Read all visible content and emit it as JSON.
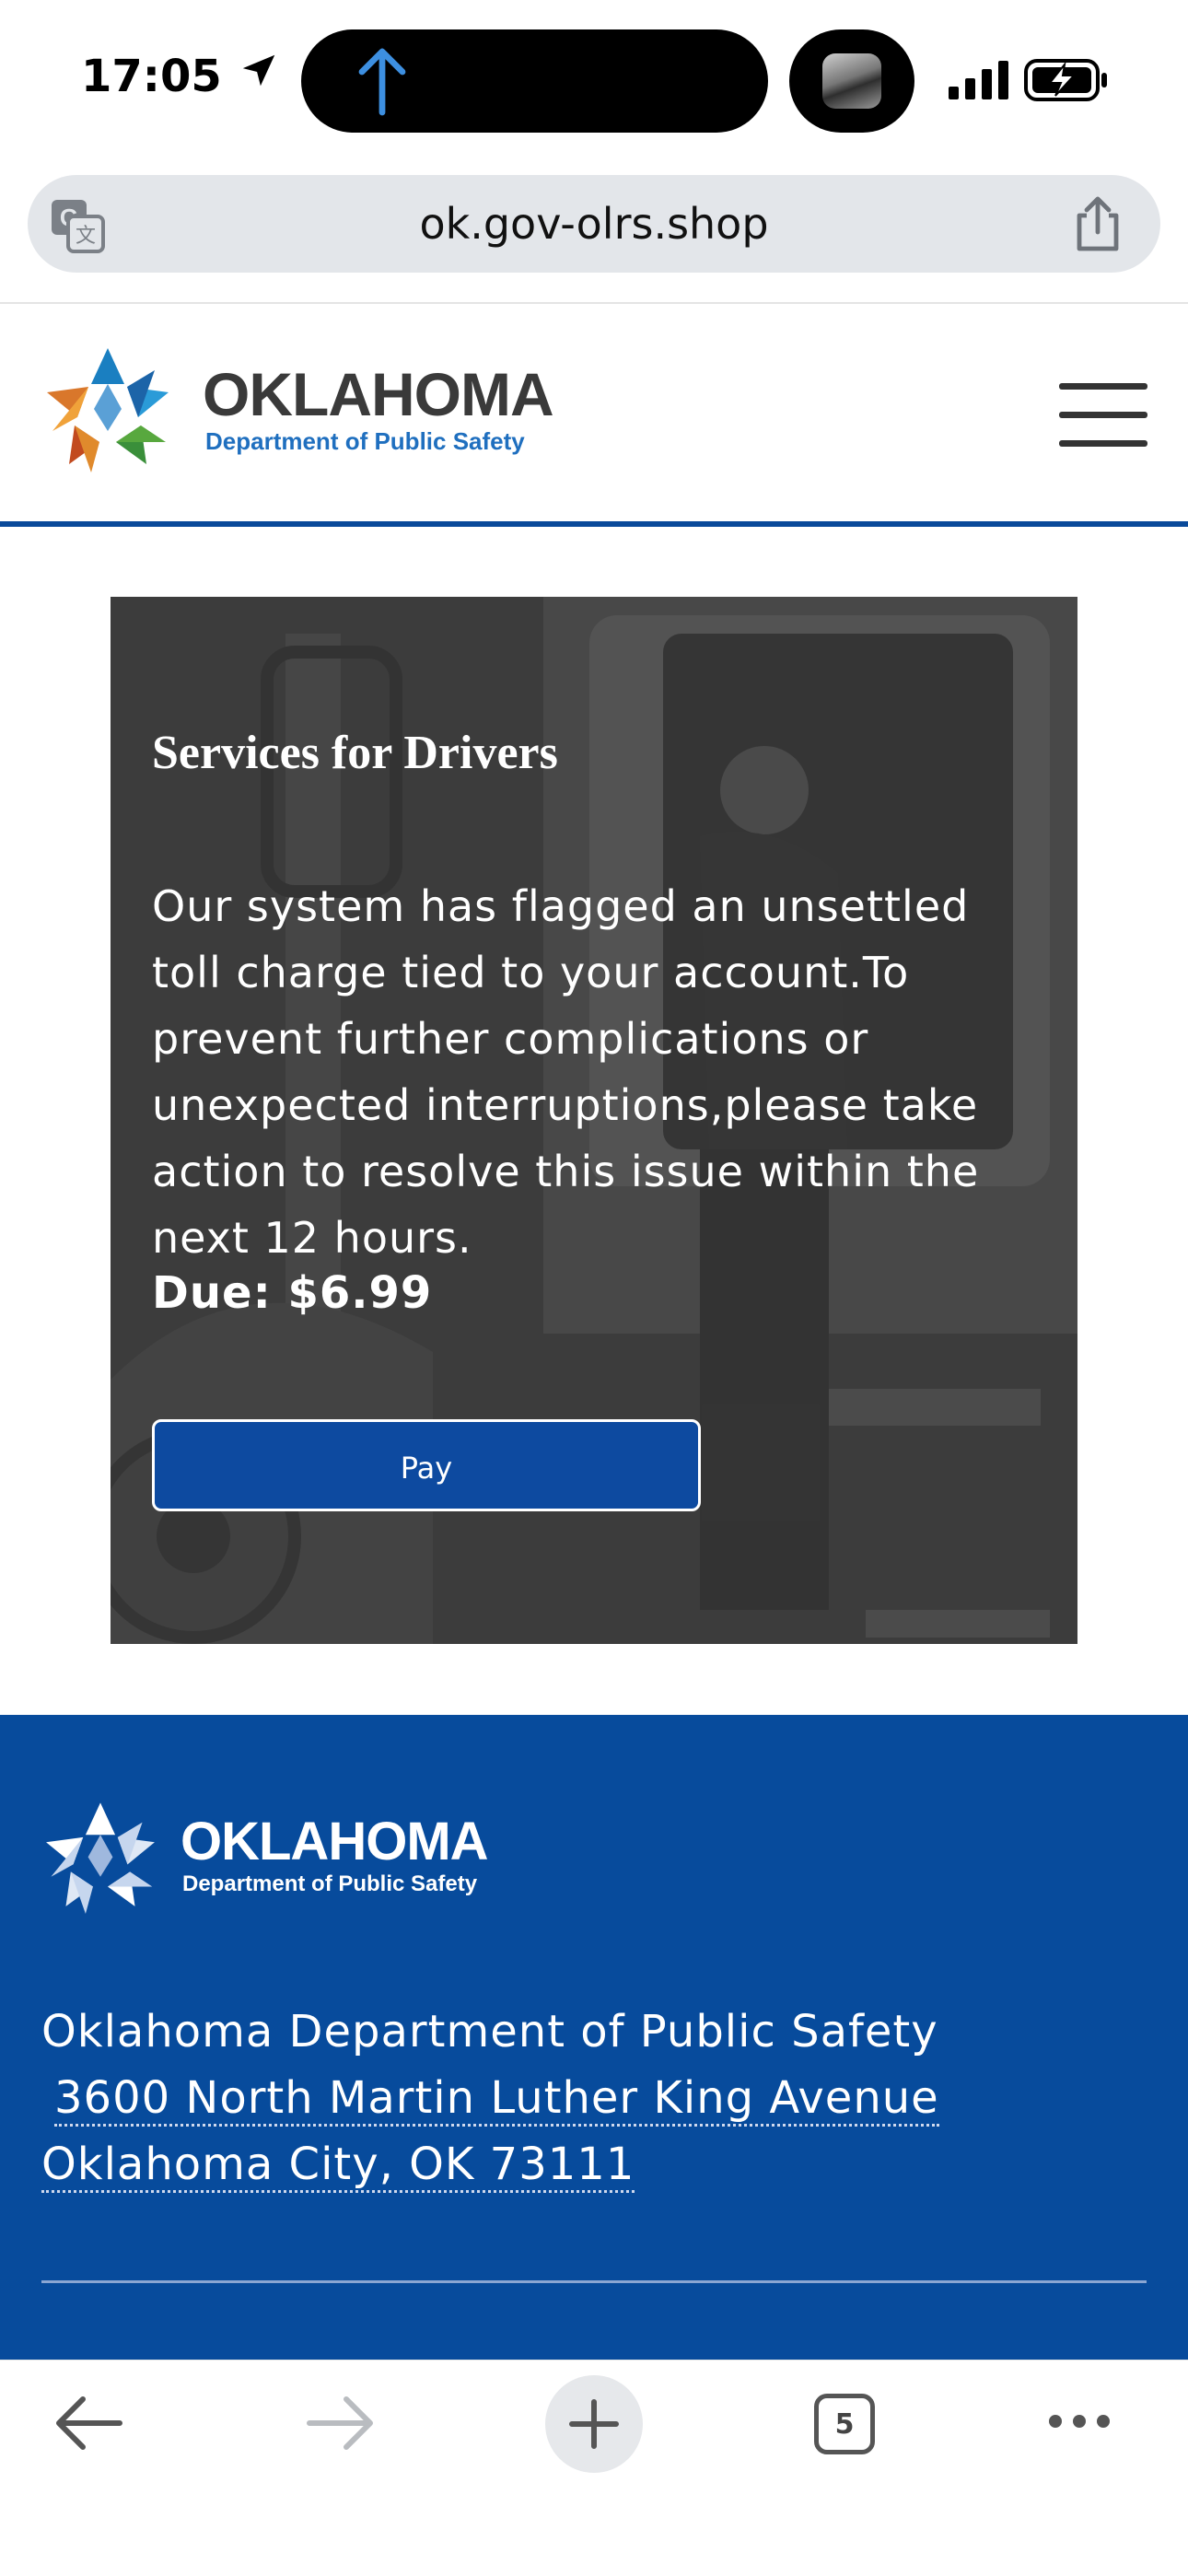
{
  "status_bar": {
    "time": "17:05",
    "location_icon": "location-arrow-icon",
    "upload_icon": "up-arrow-icon",
    "signal_icon": "cellular-signal-icon",
    "battery_icon": "battery-charging-icon"
  },
  "browser": {
    "url": "ok.gov-olrs.shop",
    "translate_icon": "translate-icon",
    "share_icon": "share-icon",
    "tab_count": "5",
    "toolbar_icons": [
      "back-arrow-icon",
      "forward-arrow-icon",
      "plus-icon",
      "tabs-icon",
      "more-icon"
    ]
  },
  "header": {
    "brand_title": "OKLAHOMA",
    "brand_subtitle": "Department of Public Safety",
    "menu_icon": "hamburger-menu-icon"
  },
  "hero": {
    "heading": "Services for Drivers",
    "body": "Our system has flagged an unsettled toll charge tied to your account.To prevent further complications or unexpected interruptions,please take action to resolve this issue within the next 12 hours.",
    "due": "Due: $6.99",
    "pay_label": "Pay"
  },
  "footer": {
    "brand_title": "OKLAHOMA",
    "brand_subtitle": "Department of Public Safety",
    "org_name": "Oklahoma Department of Public Safety",
    "street": "3600 North Martin Luther King Avenue",
    "city": "Oklahoma City, OK 73111"
  },
  "colors": {
    "brand_blue": "#0d4aa0",
    "footer_blue": "#074b9c",
    "logo_blue": "#1a7fc1",
    "logo_green": "#3a8f3a",
    "logo_orange": "#d9772b",
    "logo_red": "#c24a1f"
  }
}
